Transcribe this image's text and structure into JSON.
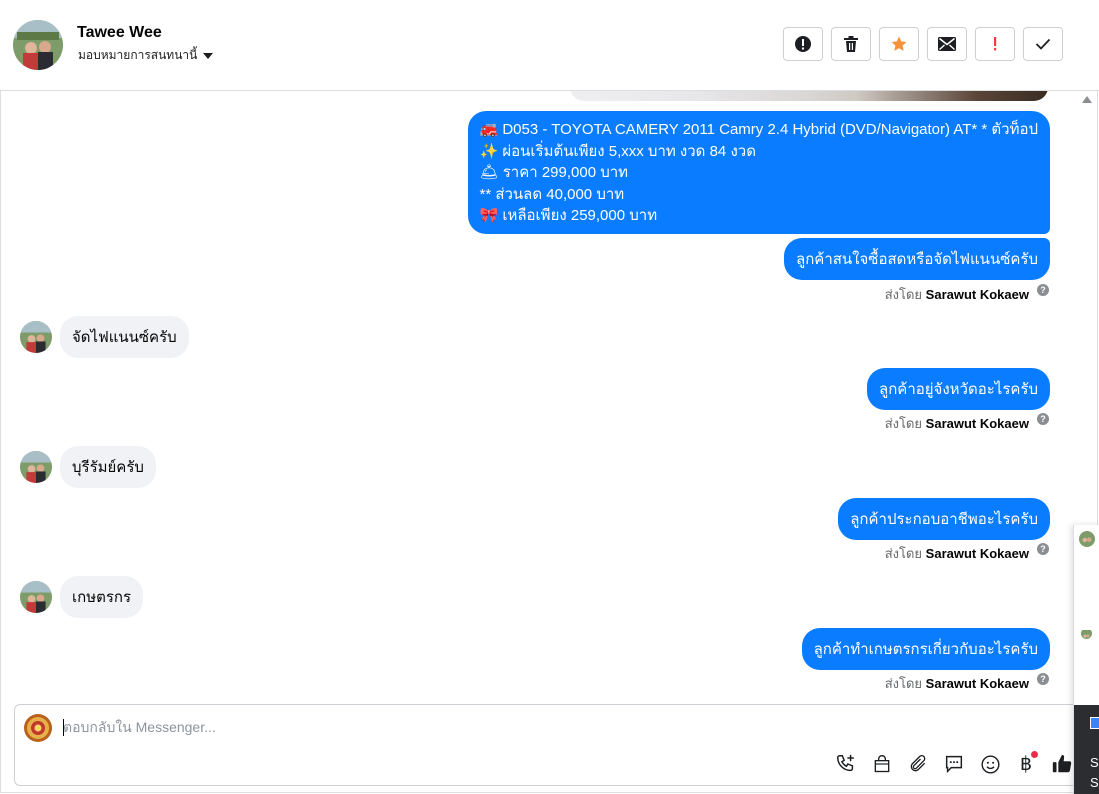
{
  "header": {
    "contact_name": "Tawee Wee",
    "assign_label": "มอบหมายการสนทนานี้"
  },
  "toolbar": {
    "buttons": [
      {
        "name": "spam-button",
        "icon": "exclamation-circle-icon"
      },
      {
        "name": "delete-button",
        "icon": "trash-icon"
      },
      {
        "name": "star-button",
        "icon": "star-icon",
        "color": "#f7923b"
      },
      {
        "name": "mark-unread-button",
        "icon": "envelope-icon"
      },
      {
        "name": "follow-up-button",
        "icon": "exclamation-icon",
        "color": "#fa383e"
      },
      {
        "name": "done-button",
        "icon": "check-icon"
      }
    ]
  },
  "conversation": {
    "product_message": {
      "lines": [
        "🚒 D053 - TOYOTA CAMERY 2011 Camry 2.4 Hybrid (DVD/Navigator) AT* * ตัวท็อป",
        "✨ ผ่อนเริ่มต้นเพียง 5,xxx บาท งวด 84 งวด",
        "🛎 ราคา 299,000 บาท",
        "** ส่วนลด 40,000 บาท",
        "🎀 เหลือเพียง 259,000 บาท"
      ]
    },
    "messages": [
      {
        "from": "page",
        "text": "ลูกค้าสนใจซื้อสดหรือจัดไฟแนนซ์ครับ",
        "sent_prefix": "ส่งโดย",
        "sent_by": "Sarawut Kokaew"
      },
      {
        "from": "customer",
        "text": "จัดไฟแนนซ์ครับ"
      },
      {
        "from": "page",
        "text": "ลูกค้าอยู่จังหวัดอะไรครับ",
        "sent_prefix": "ส่งโดย",
        "sent_by": "Sarawut Kokaew"
      },
      {
        "from": "customer",
        "text": "บุรีรัมย์ครับ"
      },
      {
        "from": "page",
        "text": "ลูกค้าประกอบอาชีพอะไรครับ",
        "sent_prefix": "ส่งโดย",
        "sent_by": "Sarawut Kokaew"
      },
      {
        "from": "customer",
        "text": "เกษตรกร"
      },
      {
        "from": "page",
        "text": "ลูกค้าทำเกษตรกรเกี่ยวกับอะไรครับ",
        "sent_prefix": "ส่งโดย",
        "sent_by": "Sarawut Kokaew"
      }
    ],
    "outgoing_color": "#0a7cff",
    "incoming_color": "#f0f2f5"
  },
  "composer": {
    "placeholder": "ตอบกลับใน Messenger...",
    "icons": [
      "phone-plus-icon",
      "shopping-bag-icon",
      "paperclip-icon",
      "saved-reply-icon",
      "emoji-icon",
      "baht-icon",
      "thumbs-up-icon"
    ]
  },
  "side_panel": {
    "partial_text": "S"
  }
}
